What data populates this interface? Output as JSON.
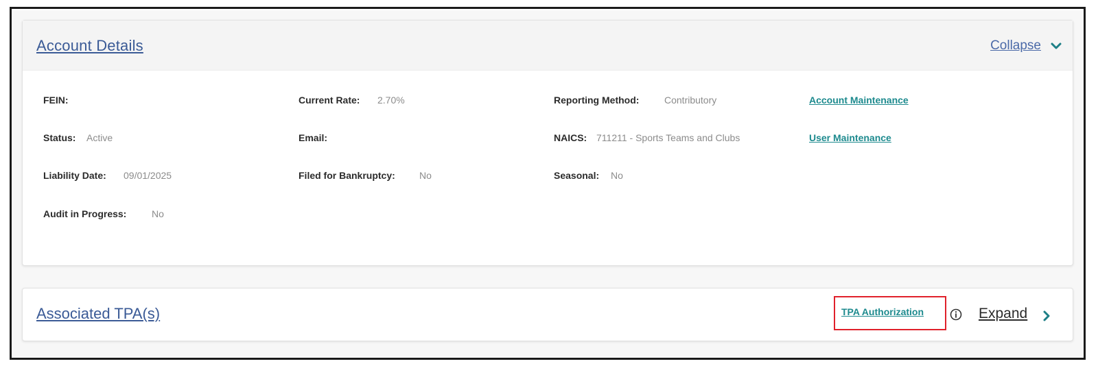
{
  "account_details": {
    "title": "Account Details",
    "toggle_label": "Collapse",
    "toggle_icon": "chevron-down-icon",
    "fields": {
      "fein": {
        "label": "FEIN:",
        "value": ""
      },
      "current_rate": {
        "label": "Current Rate:",
        "value": "2.70%"
      },
      "reporting_method": {
        "label": "Reporting Method:",
        "value": "Contributory"
      },
      "status": {
        "label": "Status:",
        "value": "Active"
      },
      "email": {
        "label": "Email:",
        "value": ""
      },
      "naics": {
        "label": "NAICS:",
        "value": "711211 - Sports Teams and Clubs"
      },
      "liability_date": {
        "label": "Liability Date:",
        "value": "09/01/2025"
      },
      "filed_bankruptcy": {
        "label": "Filed for Bankruptcy:",
        "value": "No"
      },
      "seasonal": {
        "label": "Seasonal:",
        "value": "No"
      },
      "audit": {
        "label": "Audit in Progress:",
        "value": "No"
      }
    },
    "links": {
      "account_maintenance": "Account Maintenance",
      "user_maintenance": "User Maintenance"
    }
  },
  "associated_tpa": {
    "title": "Associated TPA(s)",
    "tpa_authorization_label": "TPA Authorization",
    "info_icon": "info-icon",
    "toggle_label": "Expand",
    "toggle_icon": "chevron-right-icon"
  },
  "colors": {
    "title_link": "#3a5a96",
    "teal_link": "#1d8a8e",
    "highlight_box": "#e0202a",
    "chevron": "#1d7f86"
  }
}
